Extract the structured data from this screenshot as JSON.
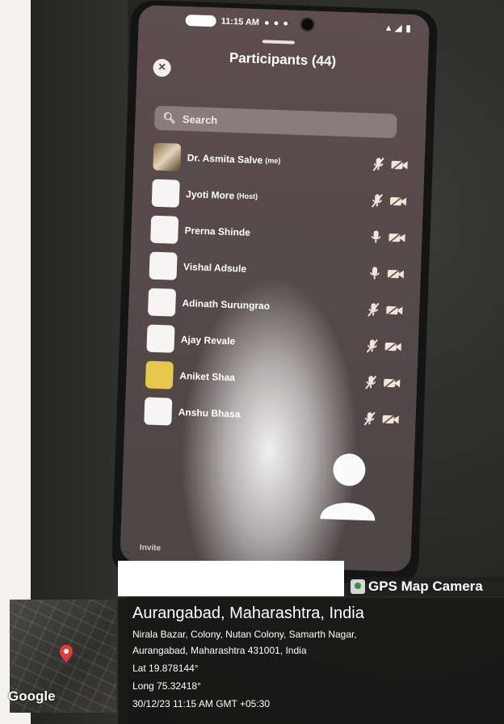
{
  "status_bar": {
    "time": "11:15 AM"
  },
  "header": {
    "title": "Participants (44)",
    "close_label": "×"
  },
  "search": {
    "placeholder": "Search"
  },
  "participants": [
    {
      "name": "Dr. Asmita Salve",
      "tag": "(me)",
      "avatar": "photo",
      "mic": "muted",
      "video": "off"
    },
    {
      "name": "Jyoti More",
      "tag": "(Host)",
      "avatar": "blank",
      "mic": "muted",
      "video": "off"
    },
    {
      "name": "Prerna Shinde",
      "tag": "",
      "avatar": "blank",
      "mic": "on",
      "video": "off"
    },
    {
      "name": "Vishal Adsule",
      "tag": "",
      "avatar": "blank",
      "mic": "on",
      "video": "off"
    },
    {
      "name": "Adinath Surungrao",
      "tag": "",
      "avatar": "blank",
      "mic": "muted",
      "video": "off"
    },
    {
      "name": "Ajay Revale",
      "tag": "",
      "avatar": "blank",
      "mic": "muted",
      "video": "off"
    },
    {
      "name": "Aniket Shaa",
      "tag": "",
      "avatar": "yellow",
      "mic": "muted",
      "video": "off"
    },
    {
      "name": "Anshu Bhasa",
      "tag": "",
      "avatar": "blank",
      "mic": "muted",
      "video": "off"
    }
  ],
  "footer": {
    "invite_label": "Invite"
  },
  "gps_overlay": {
    "brand": "GPS Map Camera",
    "city": "Aurangabad, Maharashtra, India",
    "address_line1": "Nirala Bazar, Colony, Nutan Colony, Samarth Nagar,",
    "address_line2": "Aurangabad, Maharashtra 431001, India",
    "lat": "Lat 19.878144°",
    "long": "Long 75.32418°",
    "datetime": "30/12/23 11:15 AM GMT +05:30",
    "map_credit": "Google"
  },
  "colors": {
    "screen_bg": "#574a4a",
    "icon_color": "#f2e4d8"
  }
}
